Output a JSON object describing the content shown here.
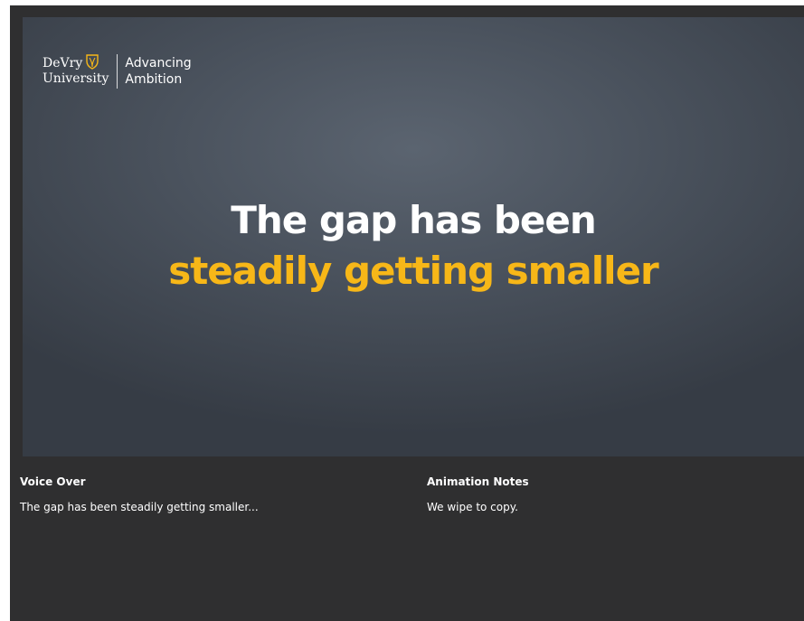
{
  "logo": {
    "name_line1": "DeVry",
    "name_line2": "University",
    "tagline_line1": "Advancing",
    "tagline_line2": "Ambition",
    "shield_icon": "devry-shield-icon",
    "shield_color": "#f7b718"
  },
  "slide": {
    "headline_line1": "The gap has been",
    "headline_line2": "steadily getting smaller",
    "accent_color": "#f7b718"
  },
  "voice_over": {
    "title": "Voice Over",
    "text": "The gap has been steadily getting smaller..."
  },
  "animation_notes": {
    "title": "Animation Notes",
    "text": "We wipe to copy."
  }
}
